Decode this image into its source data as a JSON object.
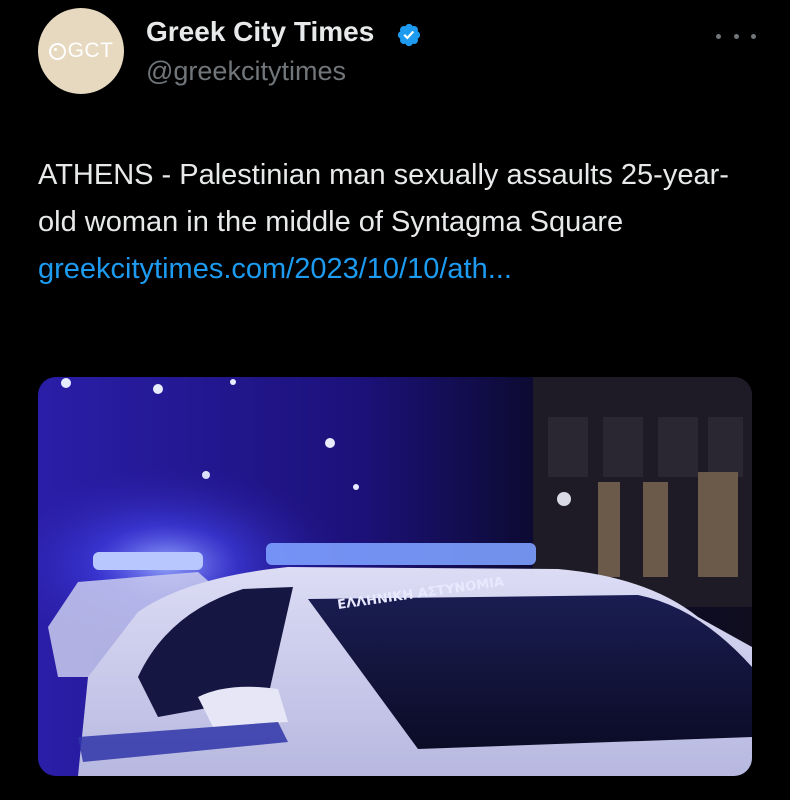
{
  "tweet": {
    "author": {
      "display_name": "Greek City Times",
      "handle": "@greekcitytimes",
      "avatar_text": "GCT",
      "verified": true
    },
    "text": "ATHENS - Palestinian man sexually assaults 25-year-old woman in the middle of Syntagma Square ",
    "link": "greekcitytimes.com/2023/10/10/ath...",
    "media": {
      "car_lettering": "ΕΛΛΗΝΙΚΗ ΑΣΤΥΝΟΜΙΑ"
    }
  },
  "colors": {
    "background": "#000000",
    "text": "#e7e9ea",
    "secondary": "#71767b",
    "link": "#1d9bf0",
    "verified": "#1d9bf0",
    "avatar_bg": "#e6d9bf"
  },
  "icons": {
    "verified": "verified-badge-icon",
    "more": "more-options-icon"
  }
}
